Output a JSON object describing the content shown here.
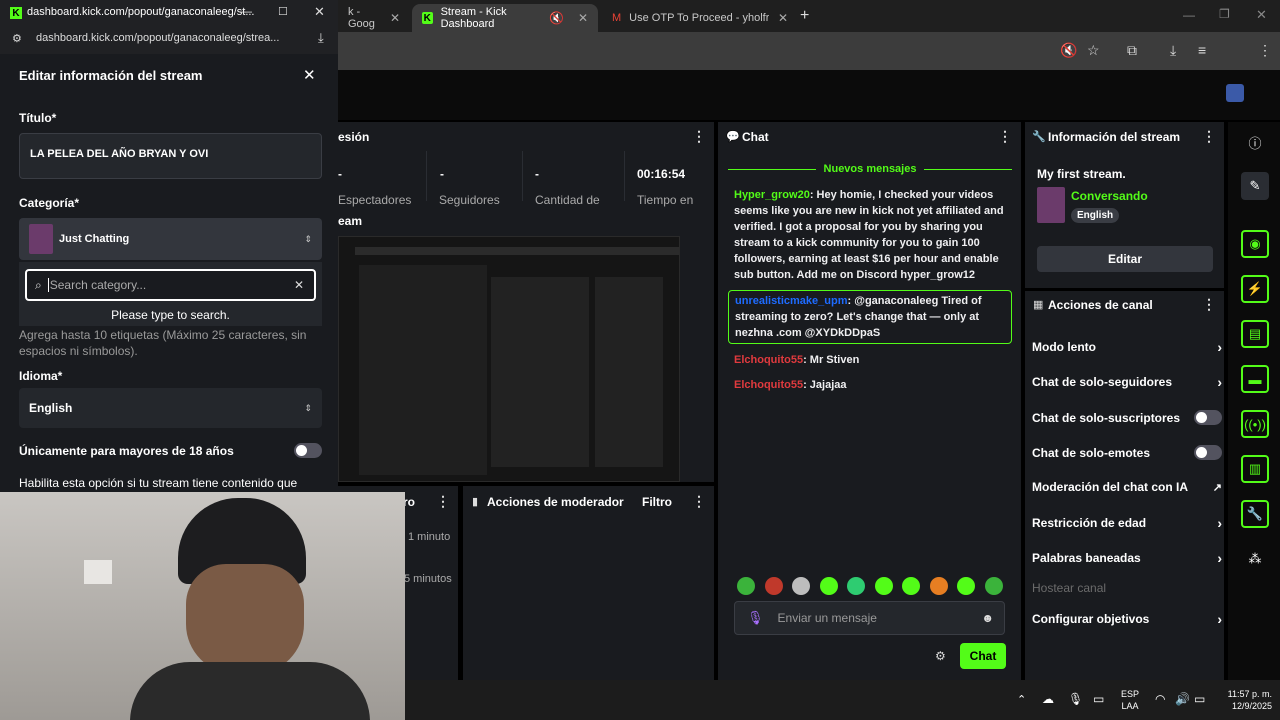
{
  "browser": {
    "tabs": [
      {
        "label": "k - Goog",
        "active": false
      },
      {
        "label": "Stream - Kick Dashboard",
        "active": true
      },
      {
        "label": "Use OTP To Proceed - yholfredy",
        "active": false
      }
    ]
  },
  "popup": {
    "url_title": "dashboard.kick.com/popout/ganaconaleeg/st...",
    "url": "dashboard.kick.com/popout/ganaconaleeg/strea...",
    "heading": "Editar información del stream",
    "title_label": "Título*",
    "title_value": "LA PELEA DEL AÑO BRYAN Y OVI",
    "category_label": "Categoría*",
    "category_value": "Just Chatting",
    "search_placeholder": "Search category...",
    "search_hint": "Please type to search.",
    "tags_help": "Agrega hasta 10 etiquetas (Máximo 25 caracteres, sin espacios ni símbolos).",
    "language_label": "Idioma*",
    "language_value": "English",
    "adult_label": "Únicamente para mayores de 18 años",
    "adult_help": "Habilita esta opción si tu stream tiene contenido que"
  },
  "dashboard": {
    "session_title": "esión",
    "stats": [
      {
        "value": "-",
        "label": "Espectadores"
      },
      {
        "value": "-",
        "label": "Seguidores"
      },
      {
        "value": "-",
        "label": "Cantidad de"
      },
      {
        "value": "00:16:54",
        "label": "Tiempo en"
      }
    ],
    "stream_label": "eam",
    "activity_title": "ro",
    "activity_items": [
      "1 minuto",
      "5 minutos"
    ],
    "mod_actions_title": "Acciones de moderador",
    "filter_label": "Filtro"
  },
  "chat": {
    "title": "Chat",
    "new_messages": "Nuevos mensajes",
    "messages": [
      {
        "user": "Hyper_grow20",
        "text": "Hey homie, I checked your videos seems like you are new in kick not yet affiliated and verified. I got a proposal for you by sharing you stream to a kick community for you to gain 100 followers, earning at least $16 per hour and enable sub button. Add me on Discord hyper_grow12",
        "color": "#53fc18"
      },
      {
        "user": "unrealisticmake_upm",
        "text": "@ganaconaleeg Tired of streaming to zero? Let's change that — only at nezhna .com @XYDkDDpaS",
        "color": "#1e6bff"
      },
      {
        "user": "Elchoquito55",
        "text": "Mr Stiven",
        "color": "#e03a3e"
      },
      {
        "user": "Elchoquito55",
        "text": "Jajajaa",
        "color": "#e03a3e"
      }
    ],
    "input_placeholder": "Enviar un mensaje",
    "send_label": "Chat"
  },
  "stream_info": {
    "title": "Información del stream",
    "stream_name": "My first stream.",
    "category": "Conversando",
    "language_badge": "English",
    "edit_label": "Editar"
  },
  "channel_actions": {
    "title": "Acciones de canal",
    "items": [
      {
        "label": "Modo lento",
        "control": "chevron"
      },
      {
        "label": "Chat de solo-seguidores",
        "control": "chevron"
      },
      {
        "label": "Chat de solo-suscriptores",
        "control": "toggle"
      },
      {
        "label": "Chat de solo-emotes",
        "control": "toggle"
      },
      {
        "label": "Moderación del chat con IA",
        "control": "external"
      },
      {
        "label": "Restricción de edad",
        "control": "chevron"
      },
      {
        "label": "Palabras baneadas",
        "control": "chevron"
      },
      {
        "label": "Hostear canal",
        "control": "none"
      },
      {
        "label": "Configurar objetivos",
        "control": "chevron"
      }
    ]
  },
  "taskbar": {
    "lang_top": "ESP",
    "lang_bottom": "LAA",
    "time": "11:57 p. m.",
    "date": "12/9/2025"
  },
  "colors": {
    "accent": "#53fc18",
    "panel": "#191b1f",
    "background": "#000000"
  }
}
